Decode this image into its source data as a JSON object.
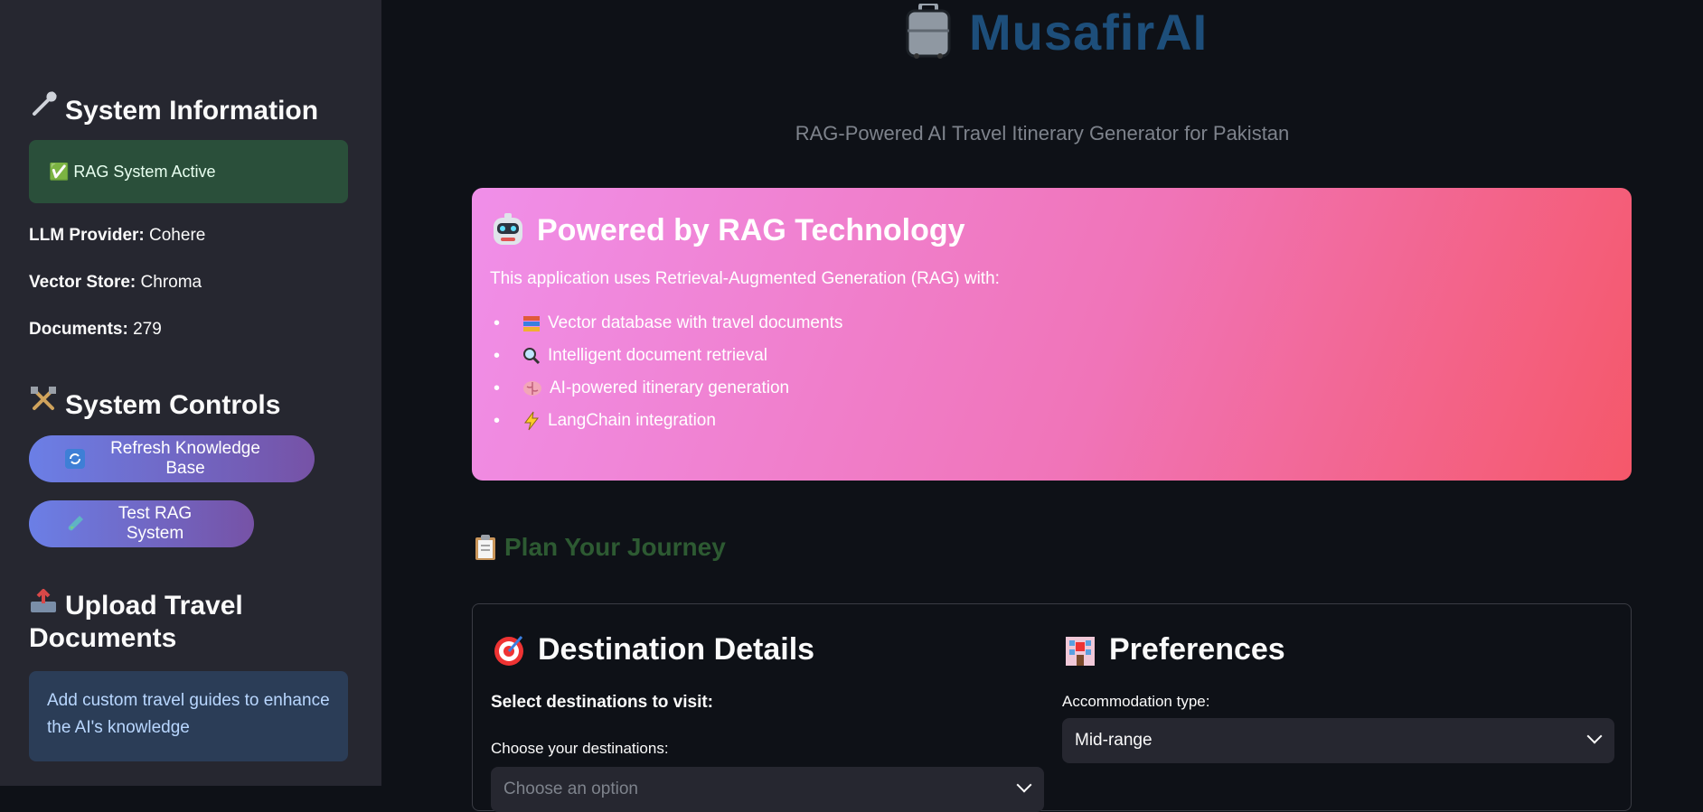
{
  "app": {
    "title": "MusafirAI",
    "subtitle": "RAG-Powered AI Travel Itinerary Generator for Pakistan"
  },
  "sidebar": {
    "system_info": {
      "title": "System Information",
      "icon": "wrench-icon"
    },
    "status": "✅ RAG System Active",
    "llm_label": "LLM Provider:",
    "llm_value": "Cohere",
    "vector_label": "Vector Store:",
    "vector_value": "Chroma",
    "docs_label": "Documents:",
    "docs_value": "279",
    "controls": {
      "title": "System Controls",
      "icon": "tools-icon"
    },
    "refresh_button": "Refresh Knowledge Base",
    "test_button": "Test RAG System",
    "upload": {
      "title_line1": "Upload Travel",
      "title_line2": "Documents",
      "icon": "outbox-tray-icon"
    },
    "upload_info": "Add custom travel guides to enhance the AI's knowledge"
  },
  "rag": {
    "heading": "Powered by RAG Technology",
    "intro": "This application uses Retrieval-Augmented Generation (RAG) with:",
    "features": [
      {
        "icon": "books-icon",
        "text": "Vector database with travel documents"
      },
      {
        "icon": "magnifier-icon",
        "text": "Intelligent document retrieval"
      },
      {
        "icon": "brain-icon",
        "text": "AI-powered itinerary generation"
      },
      {
        "icon": "lightning-icon",
        "text": "LangChain integration"
      }
    ]
  },
  "plan": {
    "title": "Plan Your Journey",
    "icon": "clipboard-icon"
  },
  "destination": {
    "title": "Destination Details",
    "select_label": "Select destinations to visit:",
    "choose_label": "Choose your destinations:",
    "placeholder": "Choose an option"
  },
  "preferences": {
    "title": "Preferences",
    "accommodation_label": "Accommodation type:",
    "accommodation_value": "Mid-range"
  },
  "colors": {
    "title": "#1d4e7a",
    "plan_title": "#2d5a32",
    "button_start": "#6b7fe6",
    "button_end": "#7652a6"
  }
}
